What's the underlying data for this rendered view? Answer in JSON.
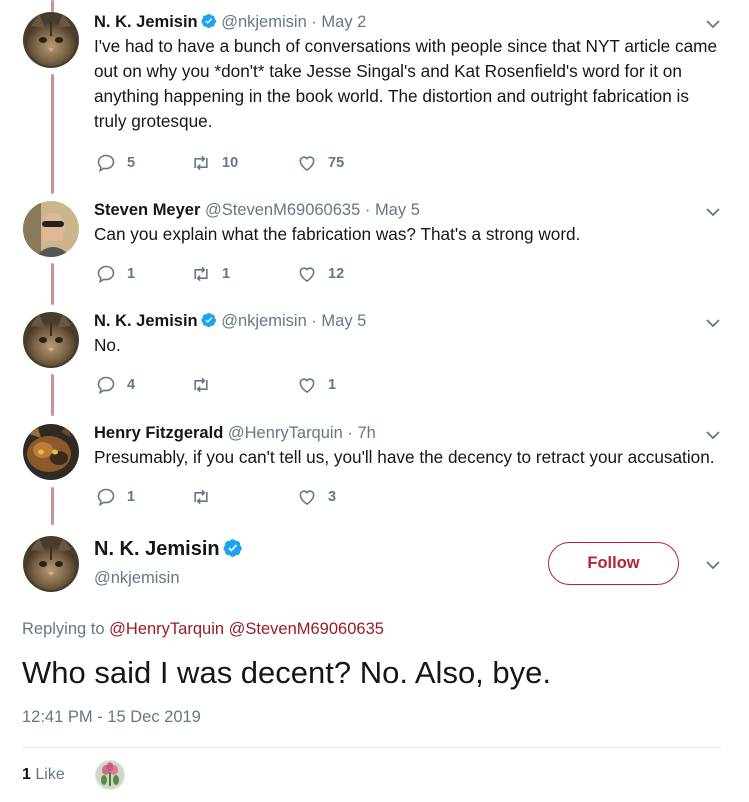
{
  "colors": {
    "accent": "#b4232f",
    "thread_line": "#c9939b",
    "muted": "#657786",
    "verified": "#1da1f2"
  },
  "tweets": [
    {
      "name": "N. K. Jemisin",
      "verified": true,
      "handle": "@nkjemisin",
      "time": "May 2",
      "text": "I've had to have a bunch of conversations with people since that NYT article came out on why you *don't* take Jesse Singal's and Kat Rosenfield's word for it on anything happening in the book world. The distortion and outright fabrication is truly grotesque.",
      "replies": "5",
      "retweets": "10",
      "likes": "75"
    },
    {
      "name": "Steven Meyer",
      "verified": false,
      "handle": "@StevenM69060635",
      "time": "May 5",
      "text": "Can you explain what the fabrication was? That's a strong word.",
      "replies": "1",
      "retweets": "1",
      "likes": "12"
    },
    {
      "name": "N. K. Jemisin",
      "verified": true,
      "handle": "@nkjemisin",
      "time": "May 5",
      "text": "No.",
      "replies": "4",
      "retweets": "",
      "likes": "1"
    },
    {
      "name": "Henry Fitzgerald",
      "verified": false,
      "handle": "@HenryTarquin",
      "time": "7h",
      "text": "Presumably, if you can't tell us, you'll have the decency to retract your accusation.",
      "replies": "1",
      "retweets": "",
      "likes": "3"
    }
  ],
  "main_tweet": {
    "name": "N. K. Jemisin",
    "handle": "@nkjemisin",
    "follow_label": "Follow",
    "replying_prefix": "Replying to",
    "replying_to": [
      "@HenryTarquin",
      "@StevenM69060635"
    ],
    "text": "Who said I was decent? No. Also, bye.",
    "timestamp": "12:41 PM - 15 Dec 2019",
    "like_count": "1",
    "like_label": "Like"
  },
  "icons": [
    "reply-icon",
    "retweet-icon",
    "like-icon",
    "verified-icon",
    "chevron-down-icon"
  ]
}
